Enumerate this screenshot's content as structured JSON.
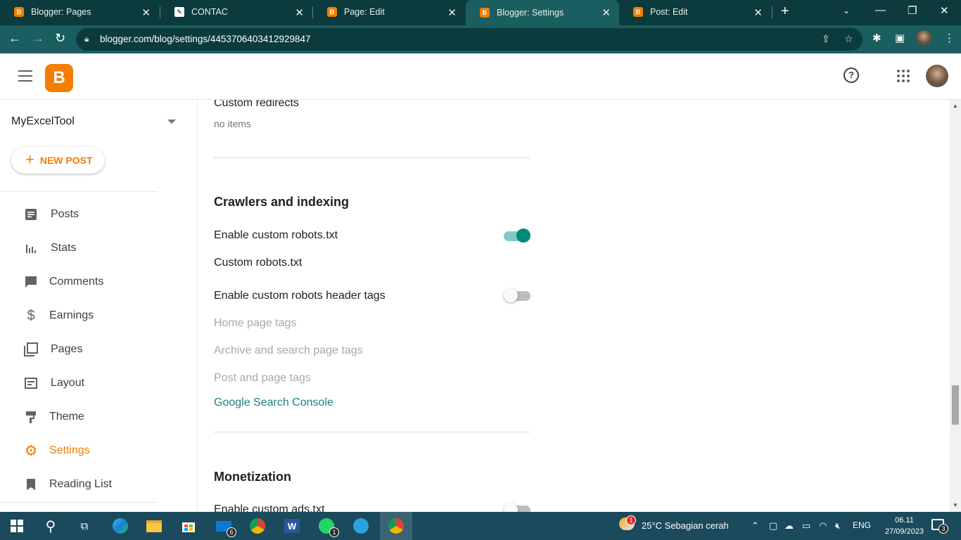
{
  "browser": {
    "tabs": [
      {
        "title": "Blogger: Pages",
        "favicon": "blogger-icon"
      },
      {
        "title": "CONTAC",
        "favicon": "feather-icon"
      },
      {
        "title": "Page: Edit",
        "favicon": "blogger-icon"
      },
      {
        "title": "Blogger: Settings",
        "favicon": "blogger-icon",
        "active": true
      },
      {
        "title": "Post: Edit",
        "favicon": "blogger-icon"
      }
    ],
    "url": "blogger.com/blog/settings/4453706403412929847"
  },
  "sidebar": {
    "blog_name": "MyExcelTool",
    "new_post_label": "NEW POST",
    "items": [
      {
        "label": "Posts",
        "icon": "posts-icon"
      },
      {
        "label": "Stats",
        "icon": "stats-icon"
      },
      {
        "label": "Comments",
        "icon": "comments-icon"
      },
      {
        "label": "Earnings",
        "icon": "dollar-icon"
      },
      {
        "label": "Pages",
        "icon": "pages-icon"
      },
      {
        "label": "Layout",
        "icon": "layout-icon"
      },
      {
        "label": "Theme",
        "icon": "theme-icon"
      },
      {
        "label": "Settings",
        "icon": "gear-icon",
        "active": true
      },
      {
        "label": "Reading List",
        "icon": "bookmark-icon"
      }
    ]
  },
  "main": {
    "custom_redirects": {
      "label": "Custom redirects",
      "value": "no items"
    },
    "crawlers": {
      "title": "Crawlers and indexing",
      "enable_robots_txt": {
        "label": "Enable custom robots.txt",
        "on": true
      },
      "custom_robots_txt": "Custom robots.txt",
      "enable_header_tags": {
        "label": "Enable custom robots header tags",
        "on": false
      },
      "home_tags": "Home page tags",
      "archive_tags": "Archive and search page tags",
      "post_tags": "Post and page tags",
      "search_console": "Google Search Console"
    },
    "monetization": {
      "title": "Monetization",
      "enable_ads_txt": {
        "label": "Enable custom ads.txt",
        "on": false
      }
    }
  },
  "taskbar": {
    "mail_badge": "6",
    "whatsapp_badge": "1",
    "weather_badge": "1",
    "weather": "25°C  Sebagian cerah",
    "language": "ENG",
    "time": "06.11",
    "date": "27/09/2023",
    "notification_count": "3"
  },
  "colors": {
    "accent": "#f57d00",
    "toggle_on": "#00897b",
    "link": "#1a7f86",
    "browser_frame": "#1a5e5f"
  }
}
